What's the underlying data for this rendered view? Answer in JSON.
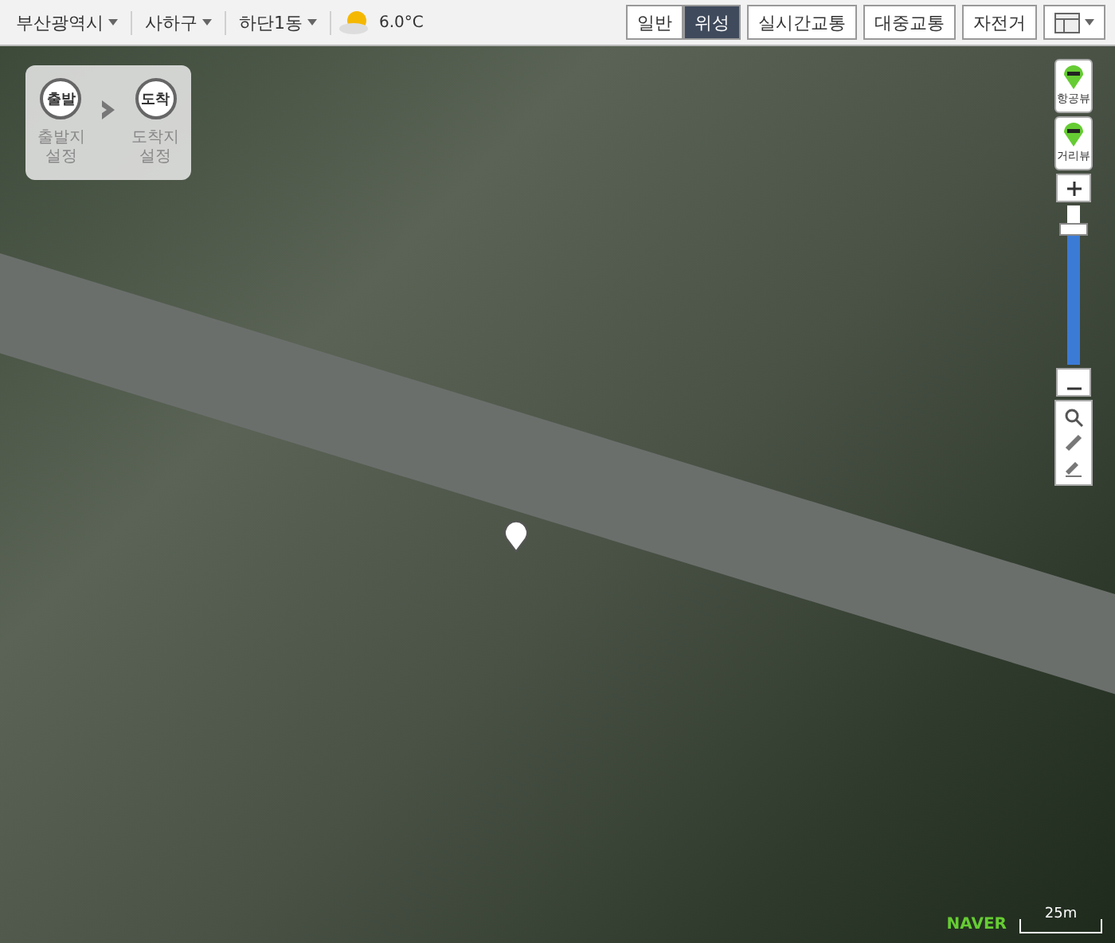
{
  "breadcrumbs": [
    "부산광역시",
    "사하구",
    "하단1동"
  ],
  "weather": {
    "temperature": "6.0°C"
  },
  "map_types": [
    {
      "label": "일반",
      "selected": false
    },
    {
      "label": "위성",
      "selected": true
    }
  ],
  "layer_buttons": [
    "실시간교통",
    "대중교통",
    "자전거"
  ],
  "route_panel": {
    "start": {
      "pin": "출발",
      "label": "출발지 설정"
    },
    "end": {
      "pin": "도착",
      "label": "도착지 설정"
    }
  },
  "view_buttons": [
    "항공뷰",
    "거리뷰"
  ],
  "zoom": {
    "level": 0.88
  },
  "logo": "NAVER",
  "scale": "25m"
}
